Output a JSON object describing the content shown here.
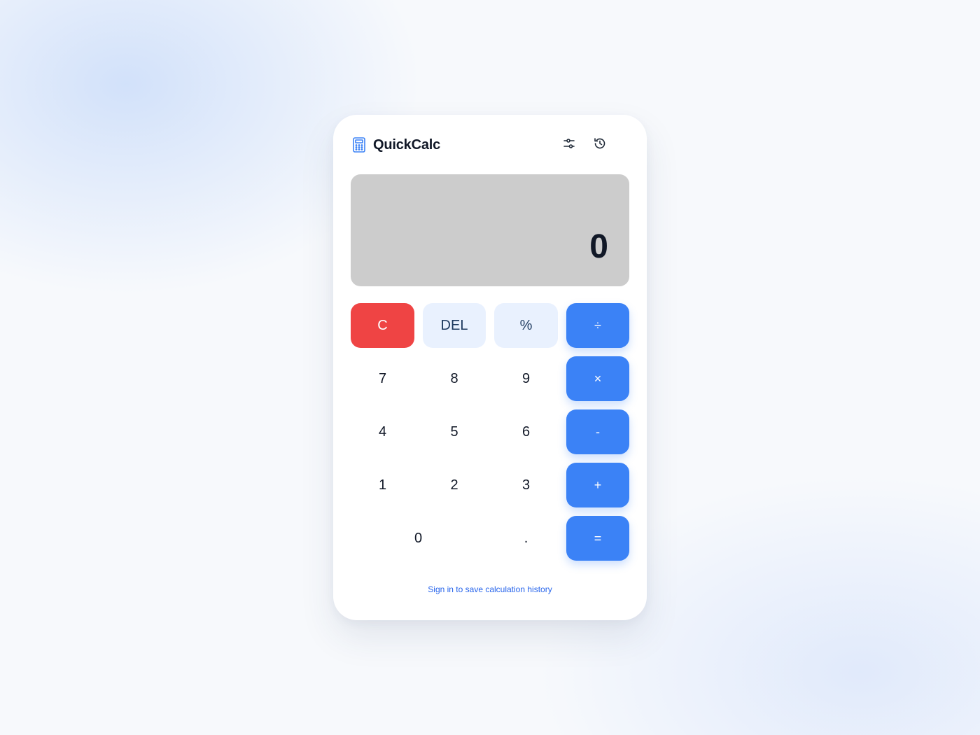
{
  "app": {
    "title": "QuickCalc"
  },
  "header": {
    "settings_icon": "sliders-icon",
    "history_icon": "history-icon"
  },
  "display": {
    "value": "0"
  },
  "keys": {
    "clear": "C",
    "del": "DEL",
    "percent": "%",
    "divide": "÷",
    "seven": "7",
    "eight": "8",
    "nine": "9",
    "multiply": "×",
    "four": "4",
    "five": "5",
    "six": "6",
    "subtract": "-",
    "one": "1",
    "two": "2",
    "three": "3",
    "add": "+",
    "zero": "0",
    "decimal": ".",
    "equals": "="
  },
  "footer": {
    "sign_in_text": "Sign in to save calculation history"
  },
  "colors": {
    "clear": "#ef4444",
    "operator": "#3b82f6",
    "function": "#e9f1fe",
    "display_bg": "#cccccc",
    "link": "#2563eb"
  }
}
